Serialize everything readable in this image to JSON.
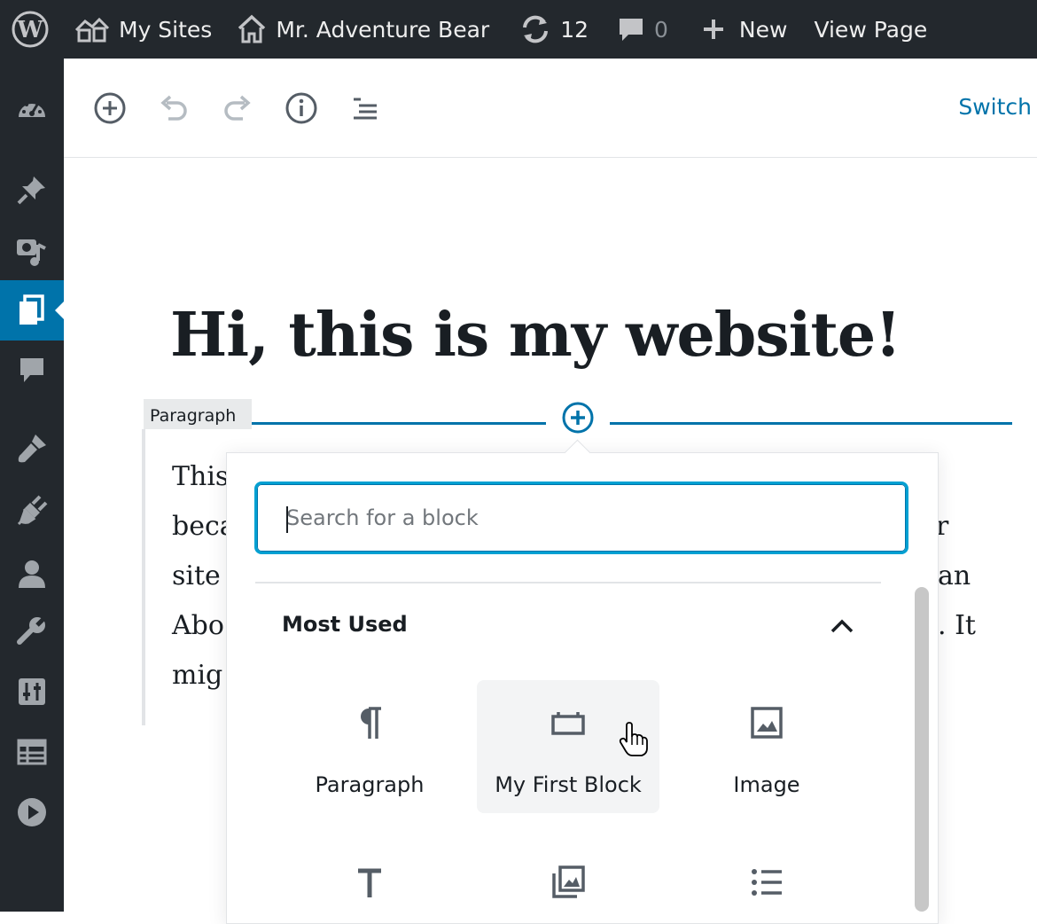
{
  "admin_bar": {
    "wp_logo_icon": "wordpress-logo-icon",
    "my_sites": "My Sites",
    "site_name": "Mr. Adventure Bear",
    "updates_count": "12",
    "comments_count": "0",
    "new_label": "New",
    "view_page": "View Page"
  },
  "sidebar": {
    "items": [
      "dashboard-icon",
      "posts-pin-icon",
      "media-icon",
      "pages-icon",
      "comments-icon",
      "appearance-brush-icon",
      "plugins-icon",
      "users-icon",
      "tools-wrench-icon",
      "settings-sliders-icon",
      "table-icon",
      "play-icon"
    ],
    "active": "pages-icon"
  },
  "toolbar": {
    "switch_label": "Switch"
  },
  "editor": {
    "title": "Hi, this is my website!",
    "block_label": "Paragraph",
    "paragraph_lines": [
      "This",
      "beca",
      "site",
      "Abo",
      "mig"
    ],
    "paragraph_right": [
      "r",
      "an",
      ". It"
    ]
  },
  "inserter": {
    "search_placeholder": "Search for a block",
    "panel_title": "Most Used",
    "blocks": [
      {
        "label": "Paragraph",
        "icon": "paragraph-icon"
      },
      {
        "label": "My First Block",
        "icon": "my-first-block-icon"
      },
      {
        "label": "Image",
        "icon": "image-icon"
      },
      {
        "label": "",
        "icon": "heading-icon"
      },
      {
        "label": "",
        "icon": "gallery-icon"
      },
      {
        "label": "",
        "icon": "list-icon"
      }
    ]
  },
  "colors": {
    "admin_bg": "#23282d",
    "accent": "#0073aa",
    "focus": "#00a0d2",
    "text": "#191e23"
  }
}
